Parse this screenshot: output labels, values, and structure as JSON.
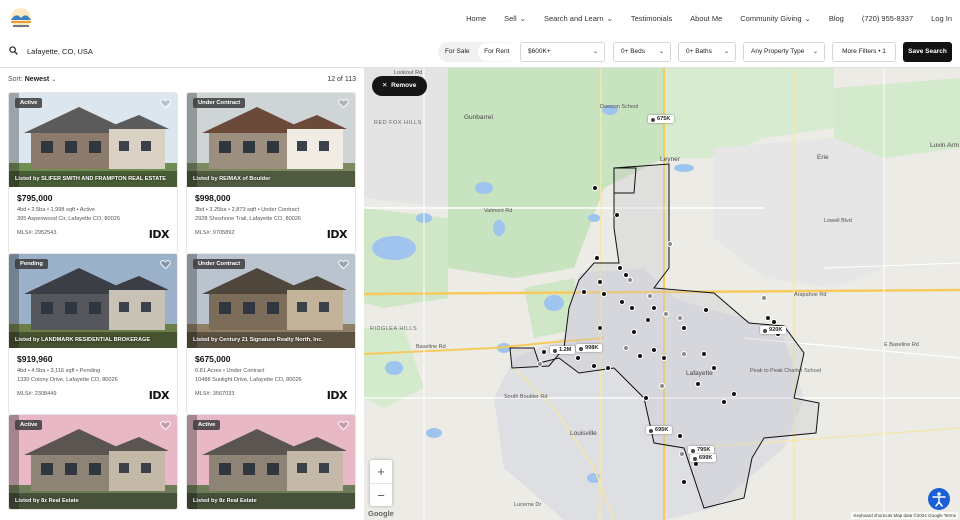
{
  "nav": {
    "items": [
      {
        "label": "Home",
        "dropdown": false
      },
      {
        "label": "Sell",
        "dropdown": true
      },
      {
        "label": "Search and Learn",
        "dropdown": true
      },
      {
        "label": "Testimonials",
        "dropdown": false
      },
      {
        "label": "About Me",
        "dropdown": false
      },
      {
        "label": "Community Giving",
        "dropdown": true
      },
      {
        "label": "Blog",
        "dropdown": false
      },
      {
        "label": "(720) 955-8337",
        "dropdown": false
      },
      {
        "label": "Log In",
        "dropdown": false
      }
    ]
  },
  "search": {
    "value": "Lafayette, CO, USA"
  },
  "filters": {
    "for_sale": "For Sale",
    "for_rent": "For Rent",
    "price": "$600K+",
    "beds": "0+ Beds",
    "baths": "0+ Baths",
    "property_type": "Any Property Type",
    "more_filters": "More Filters • 1",
    "save_search": "Save Search"
  },
  "list": {
    "sort_label": "Sort:",
    "sort_value": "Newest",
    "count": "12 of 113",
    "idx_logo": "IDX",
    "cards": [
      {
        "badge": "Active",
        "listed_by": "Listed by SLIFER SMITH AND FRAMPTON REAL ESTATE",
        "price": "$795,000",
        "details": "4bd • 2.5ba • 1,998 sqft • Active",
        "address": "395 Aspenwood Cir, Lafayette CO, 80026",
        "mls": "MLS#: 2952543"
      },
      {
        "badge": "Under Contract",
        "listed_by": "Listed by RE/MAX of Boulder",
        "price": "$998,000",
        "details": "3bd • 3.25ba • 2,873 sqft • Under Contract",
        "address": "2928 Shoshone Trail, Lafayette CO, 80026",
        "mls": "MLS#: 9705892"
      },
      {
        "badge": "Pending",
        "listed_by": "Listed by LANDMARK RESIDENTIAL BROKERAGE",
        "price": "$919,960",
        "details": "4bd • 4.5ba • 3,116 sqft • Pending",
        "address": "1330 Colony Drive, Lafayette CO, 80026",
        "mls": "MLS#: 2308449"
      },
      {
        "badge": "Under Contract",
        "listed_by": "Listed by Century 21 Signature Realty North, Inc.",
        "price": "$675,000",
        "details": "0.81 Acres • Under Contract",
        "address": "10488 Sunlight Drive, Lafayette CO, 80026",
        "mls": "MLS#: 3567033"
      },
      {
        "badge": "Active",
        "listed_by": "Listed by 8z Real Estate"
      },
      {
        "badge": "Active",
        "listed_by": "Listed by 8z Real Estate"
      }
    ]
  },
  "map": {
    "remove_label": "Remove",
    "zoom_in": "+",
    "zoom_out": "−",
    "google": "Google",
    "footer": "Keyboard shortcuts   Map data ©2024 Google   Terms",
    "price_tags": [
      "675K",
      "1.2M",
      "998K",
      "920K",
      "695K",
      "795K",
      "699K"
    ],
    "labels": {
      "gunbarrel": "Gunbarrel",
      "red_fox_hills": "RED FOX HILLS",
      "ridglea_hills": "RIDGLEA HILLS",
      "louisville": "Louisville",
      "leyner": "Leyner",
      "erie": "Erie",
      "lafayette": "Lafayette",
      "dawson_school": "Dawson School",
      "peak_to_peak": "Peak to Peak Charter School",
      "lookout_rd": "Lookout Rd",
      "valmont_rd": "Valmont Rd",
      "baseline_rd": "Baseline Rd",
      "e_baseline_rd": "E Baseline Rd",
      "arapahoe_rd": "Arapahoe Rd",
      "s_boulder_rd": "South Boulder Rd",
      "lucerne_dr": "Lucerne Dr",
      "lowell_blvd": "Lowell Blvd",
      "luvin_arm": "Luvin Arm"
    }
  },
  "colors": {
    "accent": "#111111",
    "map_water": "#9fc4ee",
    "map_park": "#c9e4c0",
    "map_road": "#f8c95d"
  }
}
